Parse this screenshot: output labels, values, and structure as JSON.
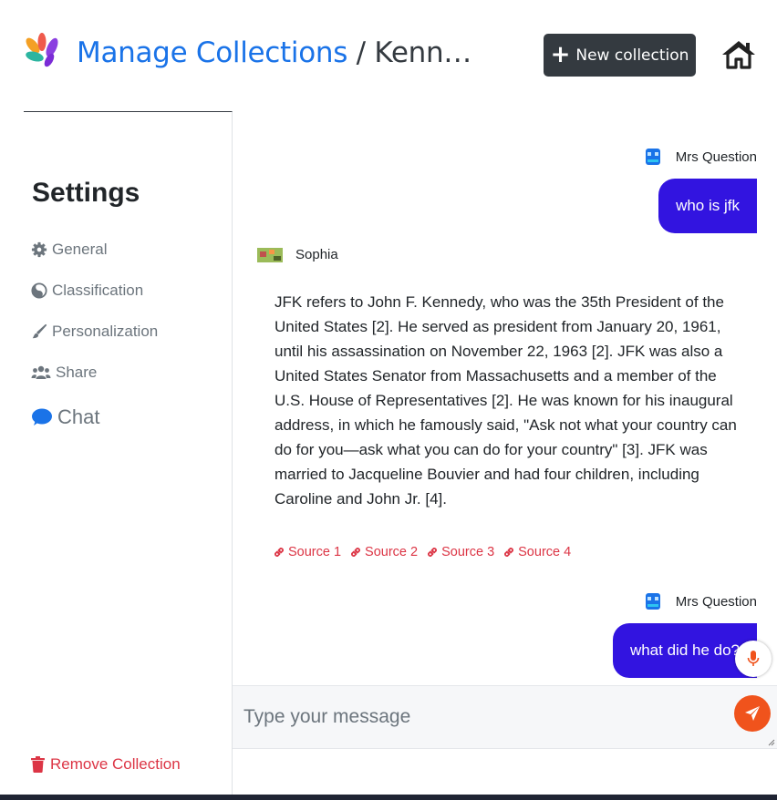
{
  "header": {
    "title_link": "Manage Collections",
    "separator": " / ",
    "breadcrumb": "Kenn…",
    "new_collection_label": "New collection",
    "home_icon": "home-icon",
    "logo_icon": "petals-logo"
  },
  "sidebar": {
    "title": "Settings",
    "items": [
      {
        "label": "General",
        "icon": "gear-icon"
      },
      {
        "label": "Classification",
        "icon": "palette-icon"
      },
      {
        "label": "Personalization",
        "icon": "brush-icon"
      },
      {
        "label": "Share",
        "icon": "users-icon"
      },
      {
        "label": "Chat",
        "icon": "chat-bubble-icon"
      }
    ],
    "remove_label": "Remove Collection"
  },
  "chat": {
    "messages": [
      {
        "role": "user",
        "author": "Mrs Question",
        "text": "who is jfk"
      },
      {
        "role": "bot",
        "author": "Sophia",
        "text": "JFK refers to John F. Kennedy, who was the 35th President of the United States [2]. He served as president from January 20, 1961, until his assassination on November 22, 1963 [2]. JFK was also a United States Senator from Massachusetts and a member of the U.S. House of Representatives [2]. He was known for his inaugural address, in which he famously said, \"Ask not what your country can do for you—ask what you can do for your country\" [3]. JFK was married to Jacqueline Bouvier and had four children, including Caroline and John Jr. [4].",
        "sources": [
          "Source 1",
          "Source 2",
          "Source 3",
          "Source 4"
        ]
      },
      {
        "role": "user",
        "author": "Mrs Question",
        "text": "what did he do?"
      }
    ],
    "input_placeholder": "Type your message"
  },
  "colors": {
    "accent_link": "#1a73e8",
    "user_bubble": "#3214e0",
    "source_link": "#dc3545",
    "send_button": "#f0531c",
    "dark_button": "#343a40"
  }
}
